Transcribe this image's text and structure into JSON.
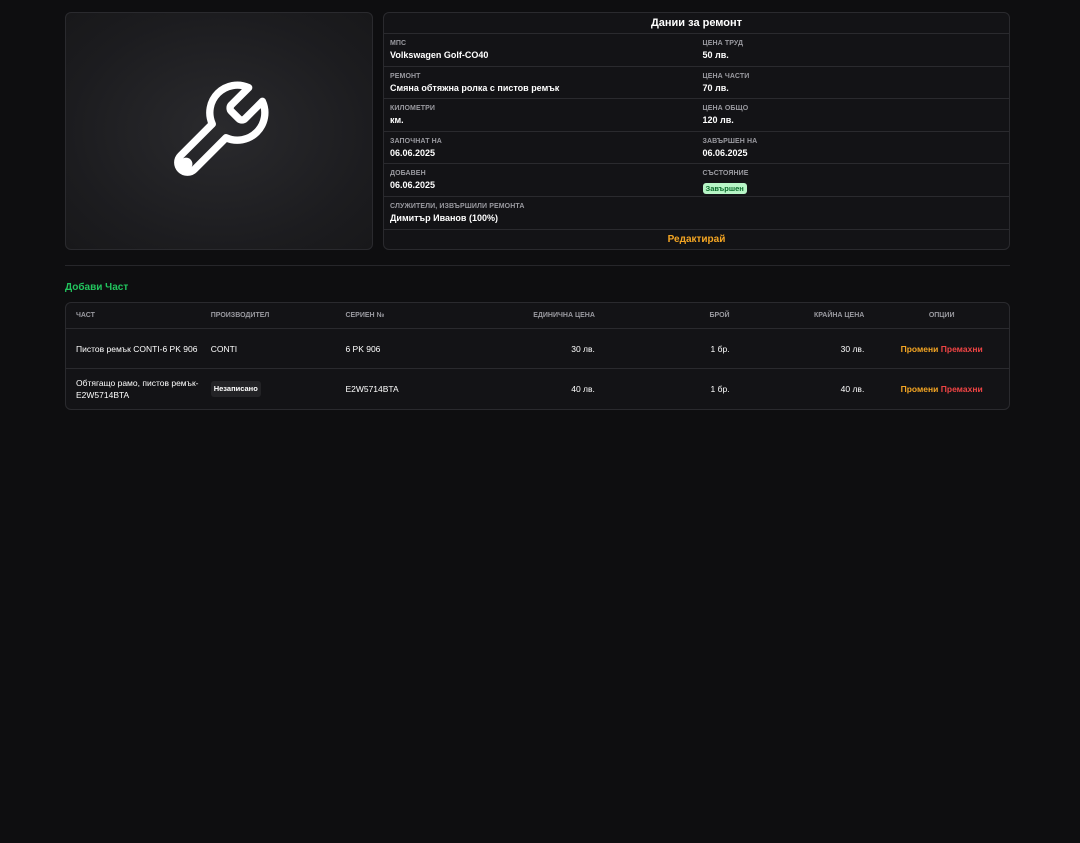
{
  "details": {
    "title": "Дании за ремонт",
    "rows": [
      [
        {
          "label": "МПС",
          "value": "Volkswagen Golf-CO40"
        },
        {
          "label": "Цена труд",
          "value": "50 лв."
        }
      ],
      [
        {
          "label": "Ремонт",
          "value": "Смяна обтяжна ролка с пистов ремък"
        },
        {
          "label": "Цена части",
          "value": "70 лв."
        }
      ],
      [
        {
          "label": "Километри",
          "value": "км."
        },
        {
          "label": "Цена общо",
          "value": "120 лв."
        }
      ],
      [
        {
          "label": "Започнат на",
          "value": "06.06.2025"
        },
        {
          "label": "Завършен на",
          "value": "06.06.2025"
        }
      ],
      [
        {
          "label": "Добавен",
          "value": "06.06.2025"
        },
        {
          "label": "Състояние",
          "value": "Завършен"
        }
      ]
    ],
    "employees_label": "Служители, извършили ремонта",
    "employees_value": "Димитър Иванов (100%)",
    "edit_label": "Редактирай"
  },
  "image": {
    "icon": "wrench-icon"
  },
  "add_part_label": "Добави Част",
  "table": {
    "headers": [
      "Част",
      "Производител",
      "Сериен №",
      "Единична цена",
      "Брой",
      "Крайна цена",
      "Опции"
    ],
    "rows": [
      {
        "part": "Пистов ремък CONTI-6 PK 906",
        "manufacturer": "CONTI",
        "serial": "6 PK 906",
        "unit_price": "30 лв.",
        "qty": "1 бр.",
        "total": "30 лв.",
        "edit": "Промени",
        "remove": "Премахни"
      },
      {
        "part": "Обтягащо рамо, пистов ремък-E2W5714BTA",
        "manufacturer": "Незаписано",
        "serial": "E2W5714BTA",
        "unit_price": "40 лв.",
        "qty": "1 бр.",
        "total": "40 лв.",
        "edit": "Промени",
        "remove": "Премахни"
      }
    ]
  },
  "colors": {
    "background": "#0e0e10",
    "accent_orange": "#f5a623",
    "accent_green": "#22c55e",
    "danger_red": "#ef4444",
    "status_bg": "#b7f5c6"
  }
}
